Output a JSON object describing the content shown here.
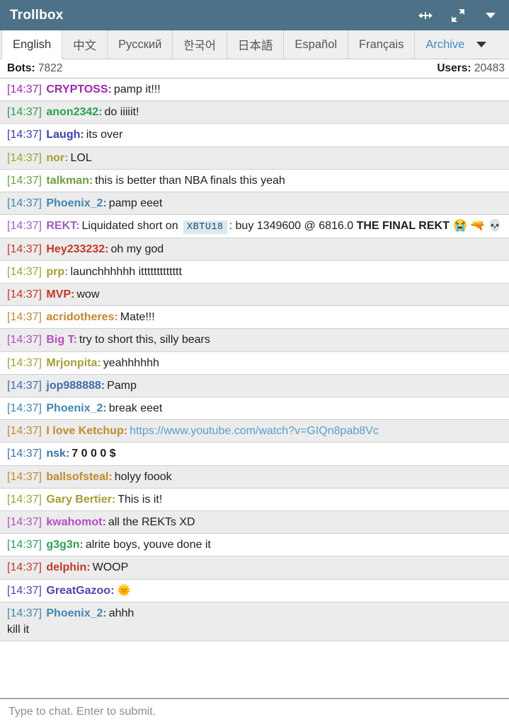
{
  "window": {
    "title": "Trollbox",
    "title_bar_color": "#4d7287",
    "actions": [
      {
        "name": "collapse-icon",
        "label": "Collapse"
      },
      {
        "name": "expand-icon",
        "label": "Expand"
      },
      {
        "name": "menu-caret-icon",
        "label": "Menu"
      }
    ]
  },
  "tabs": {
    "items": [
      {
        "label": "English",
        "active": true,
        "link": false
      },
      {
        "label": "中文",
        "active": false,
        "link": false
      },
      {
        "label": "Русский",
        "active": false,
        "link": false
      },
      {
        "label": "한국어",
        "active": false,
        "link": false
      },
      {
        "label": "日本語",
        "active": false,
        "link": false
      },
      {
        "label": "Español",
        "active": false,
        "link": false
      },
      {
        "label": "Français",
        "active": false,
        "link": false
      },
      {
        "label": "Archive",
        "active": false,
        "link": true
      }
    ],
    "overflow_caret": "▾",
    "link_color": "#3f8dbf"
  },
  "stats": {
    "bots_label": "Bots:",
    "bots_value": "7822",
    "users_label": "Users:",
    "users_value": "20483"
  },
  "messages": [
    {
      "time": "[14:37]",
      "nick": "CRYPTOSS:",
      "color": "#9c27a8",
      "text": "pamp it!!!"
    },
    {
      "time": "[14:37]",
      "nick": "anon2342:",
      "color": "#2e9e55",
      "text": "do iiiiit!"
    },
    {
      "time": "[14:37]",
      "nick": "Laugh:",
      "color": "#3b3fae",
      "text": "its over"
    },
    {
      "time": "[14:37]",
      "nick": "nor:",
      "color": "#a2a036",
      "text": "LOL"
    },
    {
      "time": "[14:37]",
      "nick": "talkman:",
      "color": "#6d9e3f",
      "text": "this is better than NBA finals this yeah"
    },
    {
      "time": "[14:37]",
      "nick": "Phoenix_2:",
      "color": "#3f87ad",
      "text": "pamp eeet"
    },
    {
      "time": "[14:37]",
      "nick": "REKT:",
      "color": "#9c5fc0",
      "rich": true,
      "pre": "Liquidated short on",
      "symbol": "XBTU18",
      "mid": ": buy 1349600 @ 6816.0 ",
      "bold": "THE FINAL REKT",
      "emojis": "😭 🔫 💀"
    },
    {
      "time": "[14:37]",
      "nick": "Hey233232:",
      "color": "#c0392b",
      "text": "oh my god"
    },
    {
      "time": "[14:37]",
      "nick": "prp:",
      "color": "#a2a036",
      "text": "launchhhhhh ittttttttttttt"
    },
    {
      "time": "[14:37]",
      "nick": "MVP:",
      "color": "#c0392b",
      "text": "wow"
    },
    {
      "time": "[14:37]",
      "nick": "acridotheres:",
      "color": "#c08a2e",
      "text": "Mate!!!"
    },
    {
      "time": "[14:37]",
      "nick": "Big T:",
      "color": "#b44ec0",
      "text": "try to short this, silly bears"
    },
    {
      "time": "[14:37]",
      "nick": "Mrjonpita:",
      "color": "#a2a036",
      "text": "yeahhhhhh"
    },
    {
      "time": "[14:37]",
      "nick": "jop988888:",
      "color": "#3f6fad",
      "text": "Pamp"
    },
    {
      "time": "[14:37]",
      "nick": "Phoenix_2:",
      "color": "#3f87ad",
      "text": "break eeet"
    },
    {
      "time": "[14:37]",
      "nick": "I love Ketchup:",
      "color": "#c08a2e",
      "link": "https://www.youtube.com/watch?v=GIQn8pab8Vc"
    },
    {
      "time": "[14:37]",
      "nick": "nsk:",
      "color": "#3f6fad",
      "bold_text": "7 0 0 0 $"
    },
    {
      "time": "[14:37]",
      "nick": "ballsofsteal:",
      "color": "#c08a2e",
      "text": "holyy foook"
    },
    {
      "time": "[14:37]",
      "nick": "Gary Bertier:",
      "color": "#a2a036",
      "text": "This is it!"
    },
    {
      "time": "[14:37]",
      "nick": "kwahomot:",
      "color": "#b44ec0",
      "text": "all the REKTs XD"
    },
    {
      "time": "[14:37]",
      "nick": "g3g3n:",
      "color": "#2e9e55",
      "text": "alrite boys, youve done it"
    },
    {
      "time": "[14:37]",
      "nick": "delphin:",
      "color": "#c0392b",
      "text": "WOOP"
    },
    {
      "time": "[14:37]",
      "nick": "GreatGazoo:",
      "color": "#5b3fae",
      "emoji_only": "🌞"
    },
    {
      "time": "[14:37]",
      "nick": "Phoenix_2:",
      "color": "#3f87ad",
      "text": "ahhh",
      "second_line": "kill it"
    }
  ],
  "composer": {
    "placeholder": "Type to chat. Enter to submit.",
    "value": ""
  }
}
